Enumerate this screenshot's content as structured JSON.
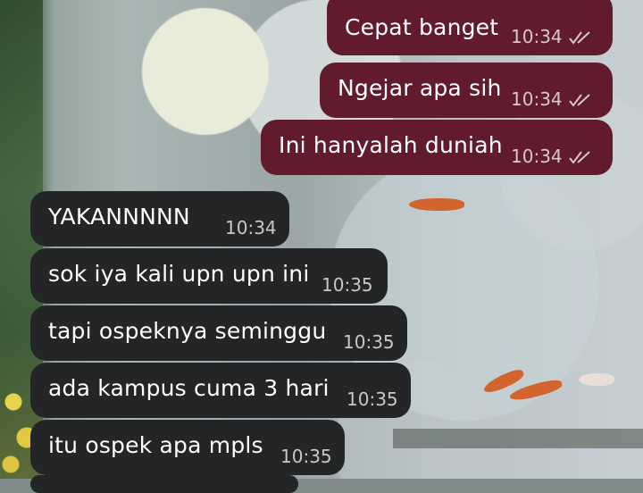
{
  "chat": {
    "messages": [
      {
        "direction": "outgoing",
        "text": "Cepat banget",
        "time": "10:34",
        "status": "read"
      },
      {
        "direction": "outgoing",
        "text": "Ngejar apa sih",
        "time": "10:34",
        "status": "read"
      },
      {
        "direction": "outgoing",
        "text": "Ini hanyalah duniah",
        "time": "10:34",
        "status": "read"
      },
      {
        "direction": "incoming",
        "text": "YAKANNNNN",
        "time": "10:34"
      },
      {
        "direction": "incoming",
        "text": "sok iya kali upn upn ini",
        "time": "10:35"
      },
      {
        "direction": "incoming",
        "text": "tapi ospeknya seminggu",
        "time": "10:35"
      },
      {
        "direction": "incoming",
        "text": "ada kampus cuma 3 hari",
        "time": "10:35"
      },
      {
        "direction": "incoming",
        "text": "itu ospek apa mpls",
        "time": "10:35"
      }
    ]
  },
  "colors": {
    "outgoing_bubble": "#611b2d",
    "incoming_bubble": "#232526",
    "text": "#ffffff"
  },
  "icons": {
    "read_receipt": "double-check-icon"
  }
}
